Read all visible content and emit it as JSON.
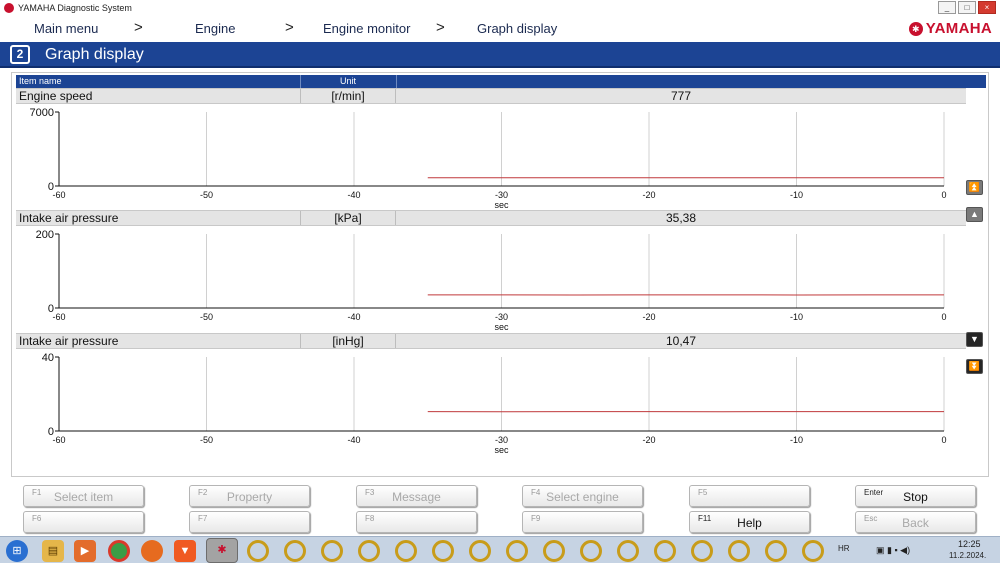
{
  "window": {
    "title": "YAMAHA Diagnostic System",
    "buttons": [
      "_",
      "□",
      "×"
    ]
  },
  "breadcrumb": {
    "items": [
      "Main menu",
      "Engine",
      "Engine monitor",
      "Graph display"
    ],
    "separator": ">"
  },
  "brand": {
    "word": "YAMAHA",
    "color": "#c8102e"
  },
  "header": {
    "title": "Graph display",
    "icon": "graph-display-icon",
    "color": "#1c4494"
  },
  "columns": {
    "item_name": "Item name",
    "unit": "Unit"
  },
  "items": [
    {
      "name": "Engine speed",
      "unit": "[r/min]",
      "value": "777"
    },
    {
      "name": "Intake air pressure",
      "unit": "[kPa]",
      "value": "35,38"
    },
    {
      "name": "Intake air pressure",
      "unit": "[inHg]",
      "value": "10,47"
    }
  ],
  "chart_data": [
    {
      "type": "line",
      "title": "",
      "xlabel": "sec",
      "ylabel": "",
      "x_ticks": [
        "-60",
        "-50",
        "-40",
        "-30",
        "-20",
        "-10",
        "0"
      ],
      "y_ticks": [
        "0",
        "7000"
      ],
      "xlim": [
        -60,
        0
      ],
      "ylim": [
        0,
        7000
      ],
      "grid": "vertical",
      "series": [
        {
          "color": "#c0393b",
          "x": [
            -35,
            -30,
            -25,
            -20,
            -15,
            -10,
            -5,
            0
          ],
          "y": [
            777,
            777,
            778,
            776,
            777,
            778,
            777,
            777
          ]
        }
      ]
    },
    {
      "type": "line",
      "title": "",
      "xlabel": "sec",
      "ylabel": "",
      "x_ticks": [
        "-60",
        "-50",
        "-40",
        "-30",
        "-20",
        "-10",
        "0"
      ],
      "y_ticks": [
        "0",
        "200"
      ],
      "xlim": [
        -60,
        0
      ],
      "ylim": [
        0,
        200
      ],
      "grid": "vertical",
      "series": [
        {
          "color": "#c0393b",
          "x": [
            -35,
            -30,
            -25,
            -20,
            -15,
            -10,
            -5,
            0
          ],
          "y": [
            35.4,
            35.4,
            35.3,
            35.4,
            35.4,
            35.3,
            35.4,
            35.4
          ]
        }
      ]
    },
    {
      "type": "line",
      "title": "",
      "xlabel": "sec",
      "ylabel": "",
      "x_ticks": [
        "-60",
        "-50",
        "-40",
        "-30",
        "-20",
        "-10",
        "0"
      ],
      "y_ticks": [
        "0",
        "40"
      ],
      "xlim": [
        -60,
        0
      ],
      "ylim": [
        0,
        40
      ],
      "grid": "vertical",
      "series": [
        {
          "color": "#c0393b",
          "x": [
            -35,
            -30,
            -25,
            -20,
            -15,
            -10,
            -5,
            0
          ],
          "y": [
            10.5,
            10.4,
            10.5,
            10.5,
            10.4,
            10.5,
            10.5,
            10.5
          ]
        }
      ]
    }
  ],
  "scroll_buttons": [
    "scroll-top-icon",
    "scroll-up-icon",
    "scroll-down-icon",
    "scroll-bottom-icon"
  ],
  "function_keys": [
    {
      "key": "F1",
      "label": "Select item",
      "enabled": false
    },
    {
      "key": "F2",
      "label": "Property",
      "enabled": false
    },
    {
      "key": "F3",
      "label": "Message",
      "enabled": false
    },
    {
      "key": "F4",
      "label": "Select engine",
      "enabled": false
    },
    {
      "key": "F5",
      "label": "",
      "enabled": false
    },
    {
      "key": "Enter",
      "label": "Stop",
      "enabled": true
    },
    {
      "key": "F6",
      "label": "",
      "enabled": false
    },
    {
      "key": "F7",
      "label": "",
      "enabled": false
    },
    {
      "key": "F8",
      "label": "",
      "enabled": false
    },
    {
      "key": "F9",
      "label": "",
      "enabled": false
    },
    {
      "key": "F11",
      "label": "Help",
      "enabled": true
    },
    {
      "key": "Esc",
      "label": "Back",
      "enabled": false
    }
  ],
  "taskbar": {
    "apps": [
      "start-icon",
      "file-explorer-icon",
      "media-player-icon",
      "chrome-icon",
      "firefox-icon",
      "brave-icon",
      "yamaha-app-icon"
    ],
    "pinned_ring_count": 16,
    "language": "HR",
    "time": "12:25",
    "date": "11.2.2024."
  }
}
